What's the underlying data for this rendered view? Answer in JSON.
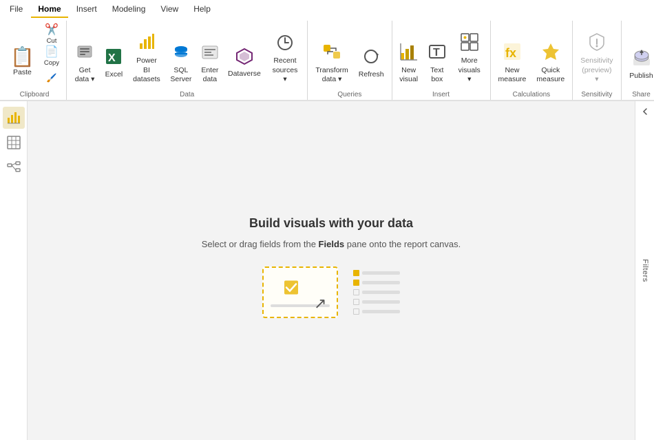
{
  "menu": {
    "tabs": [
      {
        "id": "file",
        "label": "File",
        "active": false
      },
      {
        "id": "home",
        "label": "Home",
        "active": true
      },
      {
        "id": "insert",
        "label": "Insert",
        "active": false
      },
      {
        "id": "modeling",
        "label": "Modeling",
        "active": false
      },
      {
        "id": "view",
        "label": "View",
        "active": false
      },
      {
        "id": "help",
        "label": "Help",
        "active": false
      }
    ]
  },
  "ribbon": {
    "groups": [
      {
        "id": "clipboard",
        "label": "Clipboard",
        "buttons": [
          {
            "id": "paste",
            "label": "Paste",
            "icon": "📋",
            "size": "large"
          },
          {
            "id": "cut",
            "label": "Cut",
            "icon": "✂️",
            "size": "small"
          },
          {
            "id": "copy",
            "label": "Copy",
            "icon": "📄",
            "size": "small"
          }
        ]
      },
      {
        "id": "data",
        "label": "Data",
        "buttons": [
          {
            "id": "get-data",
            "label": "Get\ndata ▾",
            "icon": "🗄️",
            "size": "large"
          },
          {
            "id": "excel",
            "label": "Excel",
            "icon": "📗",
            "size": "large"
          },
          {
            "id": "power-bi",
            "label": "Power BI\ndatasets",
            "icon": "⚡",
            "size": "large"
          },
          {
            "id": "sql-server",
            "label": "SQL\nServer",
            "icon": "🗃️",
            "size": "large"
          },
          {
            "id": "enter-data",
            "label": "Enter\ndata",
            "icon": "📊",
            "size": "large"
          },
          {
            "id": "dataverse",
            "label": "Dataverse",
            "icon": "🔷",
            "size": "large"
          },
          {
            "id": "recent-sources",
            "label": "Recent\nsources ▾",
            "icon": "🕐",
            "size": "large"
          }
        ]
      },
      {
        "id": "queries",
        "label": "Queries",
        "buttons": [
          {
            "id": "transform-data",
            "label": "Transform\ndata ▾",
            "icon": "⬡",
            "size": "large"
          },
          {
            "id": "refresh",
            "label": "Refresh",
            "icon": "🔄",
            "size": "large"
          }
        ]
      },
      {
        "id": "insert",
        "label": "Insert",
        "buttons": [
          {
            "id": "new-visual",
            "label": "New\nvisual",
            "icon": "📈",
            "size": "large"
          },
          {
            "id": "text-box",
            "label": "Text\nbox",
            "icon": "T",
            "size": "large"
          },
          {
            "id": "more-visuals",
            "label": "More\nvisuals ▾",
            "icon": "🔲",
            "size": "large"
          }
        ]
      },
      {
        "id": "calculations",
        "label": "Calculations",
        "buttons": [
          {
            "id": "new-measure",
            "label": "New\nmeasure",
            "icon": "⚡",
            "size": "large"
          },
          {
            "id": "quick-measure",
            "label": "Quick\nmeasure",
            "icon": "⚡",
            "size": "large"
          }
        ]
      },
      {
        "id": "sensitivity",
        "label": "Sensitivity",
        "buttons": [
          {
            "id": "sensitivity-preview",
            "label": "Sensitivity\n(preview) ▾",
            "icon": "🛡️",
            "size": "large",
            "grayed": true
          }
        ]
      },
      {
        "id": "share",
        "label": "Share",
        "buttons": [
          {
            "id": "publish",
            "label": "Publish",
            "icon": "☁️",
            "size": "large"
          }
        ]
      }
    ]
  },
  "sidebar": {
    "icons": [
      {
        "id": "chart",
        "icon": "📊",
        "active": true
      },
      {
        "id": "table",
        "icon": "⊞",
        "active": false
      },
      {
        "id": "model",
        "icon": "⬡",
        "active": false
      }
    ]
  },
  "canvas": {
    "title": "Build visuals with your data",
    "subtitle_before": "Select or drag fields from the ",
    "subtitle_bold": "Fields",
    "subtitle_after": " pane onto the report canvas."
  },
  "filters": {
    "label": "Filters"
  }
}
